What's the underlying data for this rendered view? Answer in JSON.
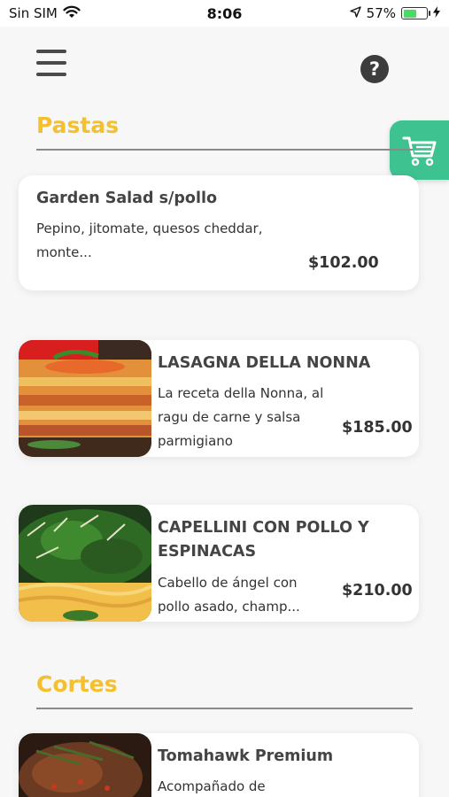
{
  "status_bar": {
    "carrier": "Sin SIM",
    "time": "8:06",
    "battery_pct": "57%",
    "battery_level": 0.57
  },
  "header": {
    "menu_icon": "hamburger-menu-icon",
    "help_label": "?",
    "cart_icon": "shopping-cart-icon"
  },
  "colors": {
    "accent_yellow": "#f5c02e",
    "cart_green": "#3ec28f"
  },
  "sections": [
    {
      "title": "Pastas",
      "items": [
        {
          "title": "Garden Salad s/pollo",
          "desc_lines": [
            "Pepino, jitomate, quesos cheddar,",
            "monte..."
          ],
          "price": "$102.00",
          "has_image": false
        },
        {
          "title": "LASAGNA DELLA NONNA",
          "desc_lines": [
            "La receta della Nonna, al",
            "ragu de carne y salsa",
            "parmigiano"
          ],
          "price": "$185.00",
          "has_image": true
        },
        {
          "title_lines": [
            "CAPELLINI CON POLLO Y",
            "ESPINACAS"
          ],
          "desc_lines": [
            "Cabello de ángel con",
            "pollo asado, champ..."
          ],
          "price": "$210.00",
          "has_image": true
        }
      ]
    },
    {
      "title": "Cortes",
      "items": [
        {
          "title": "Tomahawk Premium",
          "desc_lines": [
            "Acompañado de"
          ],
          "has_image": true
        }
      ]
    }
  ]
}
